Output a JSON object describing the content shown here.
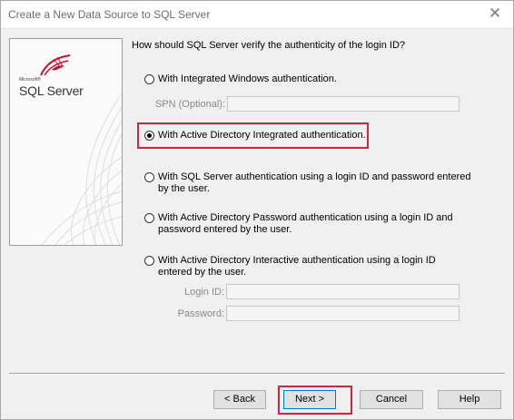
{
  "window": {
    "title": "Create a New Data Source to SQL Server"
  },
  "logo": {
    "brand_small": "Microsoft®",
    "brand_main": "SQL Server"
  },
  "question": "How should SQL Server verify the authenticity of the login ID?",
  "options": [
    {
      "label": "With Integrated Windows authentication.",
      "checked": false
    },
    {
      "label": "With Active Directory Integrated authentication.",
      "checked": true
    },
    {
      "label": "With SQL Server authentication using a login ID and password entered by the user.",
      "checked": false
    },
    {
      "label": "With Active Directory Password authentication using a login ID and password entered by the user.",
      "checked": false
    },
    {
      "label": "With Active Directory Interactive authentication using a login ID entered by the user.",
      "checked": false
    }
  ],
  "spn": {
    "label": "SPN (Optional):",
    "value": ""
  },
  "login_id": {
    "label": "Login ID:",
    "value": ""
  },
  "password": {
    "label": "Password:",
    "value": ""
  },
  "buttons": {
    "back": "< Back",
    "next": "Next >",
    "cancel": "Cancel",
    "help": "Help"
  },
  "colors": {
    "highlight": "#d0263b",
    "logo_red": "#c8102e",
    "default_button": "#0078d7"
  }
}
